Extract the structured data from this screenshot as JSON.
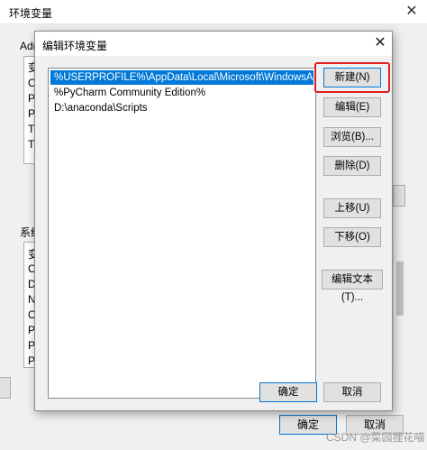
{
  "bg": {
    "title": "环境变量",
    "close": "✕",
    "user_section_label": "Adm",
    "user_table_header": "变",
    "user_rows": [
      "O",
      "Pa",
      "Py",
      "TE",
      "TN"
    ],
    "system_section_label": "系统",
    "system_table_header": "变",
    "system_rows": [
      "Co",
      "Dr",
      "N",
      "O",
      "Pa",
      "PA",
      "PF"
    ],
    "ok_label": "确定",
    "cancel_label": "取消"
  },
  "dialog": {
    "title": "编辑环境变量",
    "close": "✕",
    "entries": [
      "%USERPROFILE%\\AppData\\Local\\Microsoft\\WindowsApps",
      "%PyCharm Community Edition%",
      "D:\\anaconda\\Scripts"
    ],
    "selected_index": 0,
    "buttons": {
      "new": "新建(N)",
      "edit": "编辑(E)",
      "browse": "浏览(B)...",
      "delete": "删除(D)",
      "move_up": "上移(U)",
      "move_down": "下移(O)",
      "edit_text": "编辑文本(T)..."
    },
    "ok_label": "确定",
    "cancel_label": "取消"
  },
  "watermark": "CSDN @菜园狸花喵"
}
